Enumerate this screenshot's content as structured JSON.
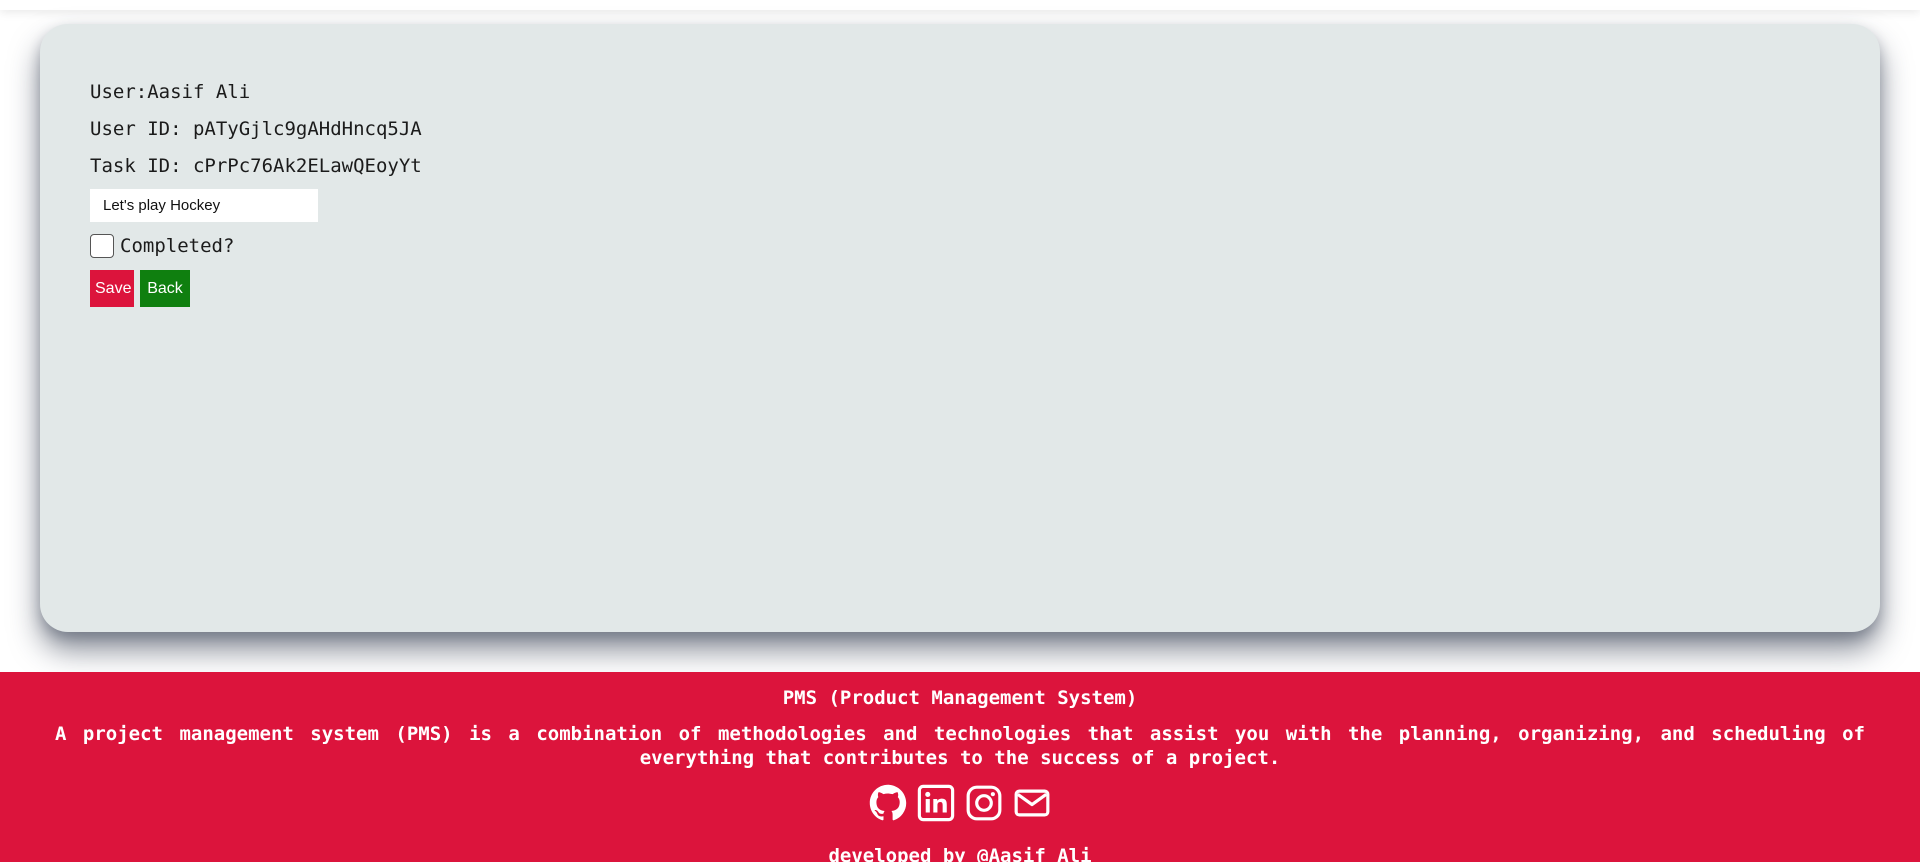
{
  "task": {
    "user_line": "User:Aasif Ali",
    "user_id_line": "User ID: pATyGjlc9gAHdHncq5JA",
    "task_id_line": "Task ID: cPrPc76Ak2ELawQEoyYt",
    "task_value": "Let's play Hockey",
    "completed_label": "Completed?",
    "completed_checked": false,
    "save_label": "Save",
    "back_label": "Back"
  },
  "footer": {
    "title": "PMS (Product Management System)",
    "description": "A project management system (PMS) is a combination of methodologies and technologies that assist you with the planning, organizing, and scheduling of everything that contributes to the success of a project.",
    "social_icons": [
      "github-icon",
      "linkedin-icon",
      "instagram-icon",
      "mail-icon"
    ],
    "credit": "developed by @Aasif Ali"
  },
  "colors": {
    "card_background": "#e2e8e8",
    "footer_background": "#dc143c",
    "save_button": "#dc143c",
    "back_button": "#0f7f0f"
  }
}
